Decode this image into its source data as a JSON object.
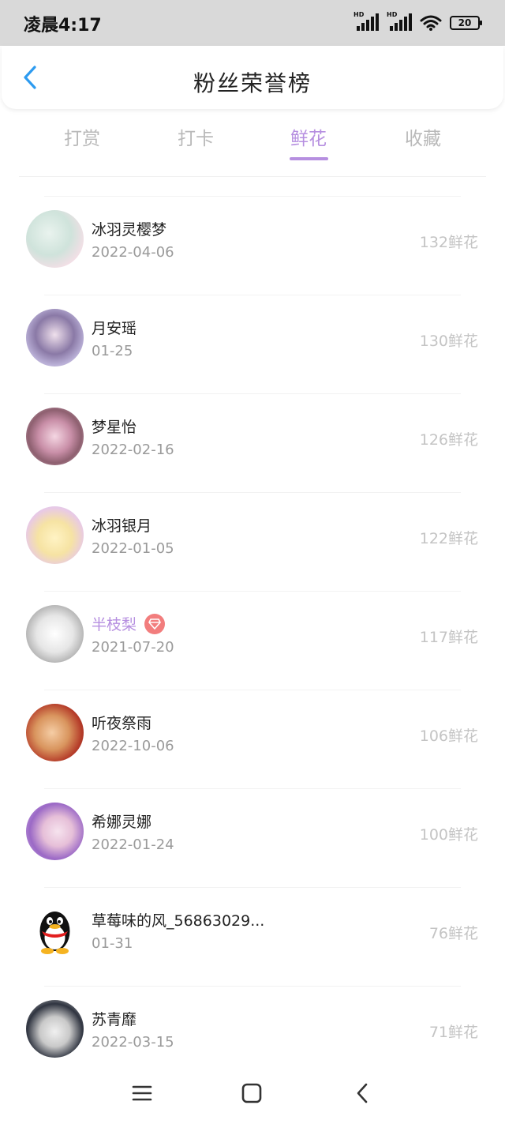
{
  "status_bar": {
    "time": "凌晨4:17",
    "battery": "20",
    "hd_label": "HD",
    "icons": [
      "signal-hd-icon",
      "signal-hd-icon",
      "wifi-icon",
      "battery-icon"
    ]
  },
  "header": {
    "title": "粉丝荣誉榜",
    "back_icon": "chevron-left-icon"
  },
  "accent_color": "#b68fe0",
  "tabs": [
    {
      "label": "打赏",
      "active": false
    },
    {
      "label": "打卡",
      "active": false
    },
    {
      "label": "鲜花",
      "active": true
    },
    {
      "label": "收藏",
      "active": false
    }
  ],
  "fans": [
    {
      "name": "冰羽灵樱梦",
      "date": "2022-04-06",
      "count": "132鲜花"
    },
    {
      "name": "月安瑶",
      "date": "01-25",
      "count": "130鲜花"
    },
    {
      "name": "梦星怡",
      "date": "2022-02-16",
      "count": "126鲜花"
    },
    {
      "name": "冰羽银月",
      "date": "2022-01-05",
      "count": "122鲜花"
    },
    {
      "name": "半枝梨",
      "date": "2021-07-20",
      "count": "117鲜花",
      "vip": true
    },
    {
      "name": "听夜祭雨",
      "date": "2022-10-06",
      "count": "106鲜花"
    },
    {
      "name": "希娜灵娜",
      "date": "2022-01-24",
      "count": "100鲜花"
    },
    {
      "name": "草莓味的风_56863029...",
      "date": "01-31",
      "count": "76鲜花"
    },
    {
      "name": "苏青靡",
      "date": "2022-03-15",
      "count": "71鲜花"
    }
  ],
  "nav_bar": {
    "icons": [
      "menu-icon",
      "home-icon",
      "back-icon"
    ]
  }
}
